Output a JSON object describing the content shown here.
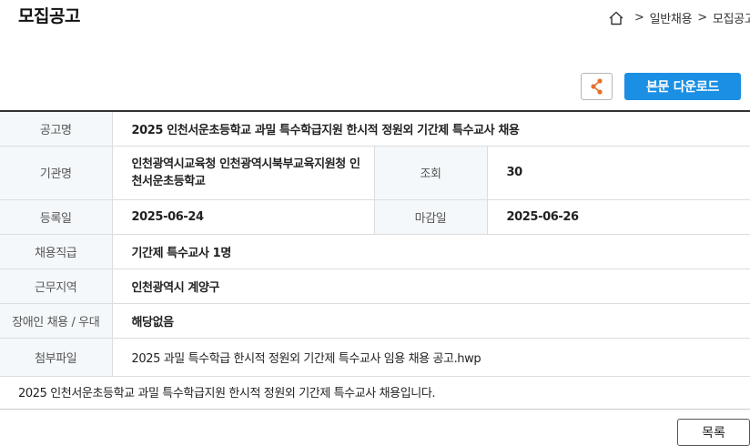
{
  "page": {
    "title": "모집공고"
  },
  "breadcrumb": {
    "home_icon": "home-icon",
    "items": [
      "일반채용",
      "모집공고"
    ],
    "separator": ">"
  },
  "actions": {
    "share_icon": "share-icon",
    "download_label": "본문 다운로드"
  },
  "notice": {
    "title_label": "공고명",
    "title_value": "2025 인천서운초등학교 과밀 특수학급지원 한시적 정원외 기간제 특수교사 채용",
    "org_label": "기관명",
    "org_value": "인천광역시교육청 인천광역시북부교육지원청 인천서운초등학교",
    "views_label": "조회",
    "views_value": "30",
    "reg_label": "등록일",
    "reg_value": "2025-06-24",
    "deadline_label": "마감일",
    "deadline_value": "2025-06-26",
    "position_label": "채용직급",
    "position_value": "기간제 특수교사 1명",
    "region_label": "근무지역",
    "region_value": "인천광역시 계양구",
    "disability_label": "장애인 채용 / 우대",
    "disability_value": "해당없음",
    "attachment_label": "첨부파일",
    "attachment_value": "2025 과밀 특수학급 한시적 정원외 기간제 특수교사 임용 채용 공고.hwp"
  },
  "description": "2025 인천서운초등학교 과밀 특수학급지원 한시적 정원외 기간제 특수교사 채용입니다.",
  "footer": {
    "list_label": "목록"
  },
  "colors": {
    "accent": "#1a8fe3",
    "share_icon": "#e8702a",
    "header_cell_bg": "#f4f8fb"
  }
}
